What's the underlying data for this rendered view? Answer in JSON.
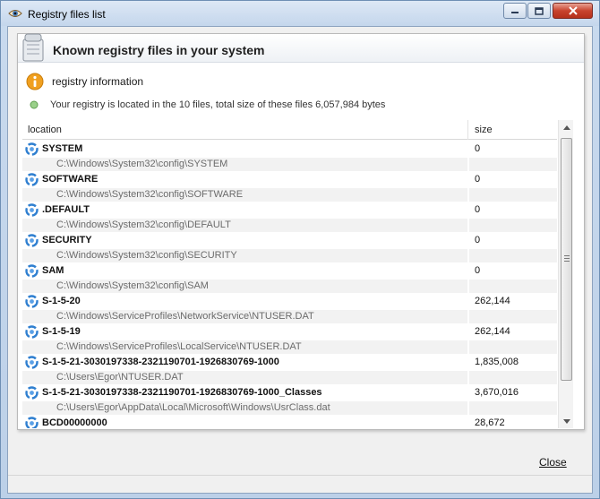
{
  "window": {
    "title": "Registry files list",
    "controls": {
      "minimize": "minimize",
      "maximize": "maximize",
      "close": "close"
    }
  },
  "header": {
    "title": "Known registry files in your system",
    "icon": "registry-hive-icon"
  },
  "info": {
    "label": "registry information",
    "icon": "info-icon",
    "description": "Your registry is located in the 10 files, total size of these files 6,057,984 bytes"
  },
  "table": {
    "columns": [
      "location",
      "size"
    ],
    "entries": [
      {
        "name": "SYSTEM",
        "path": "C:\\Windows\\System32\\config\\SYSTEM",
        "size": "0"
      },
      {
        "name": "SOFTWARE",
        "path": "C:\\Windows\\System32\\config\\SOFTWARE",
        "size": "0"
      },
      {
        "name": ".DEFAULT",
        "path": "C:\\Windows\\System32\\config\\DEFAULT",
        "size": "0"
      },
      {
        "name": "SECURITY",
        "path": "C:\\Windows\\System32\\config\\SECURITY",
        "size": "0"
      },
      {
        "name": "SAM",
        "path": "C:\\Windows\\System32\\config\\SAM",
        "size": "0"
      },
      {
        "name": "S-1-5-20",
        "path": "C:\\Windows\\ServiceProfiles\\NetworkService\\NTUSER.DAT",
        "size": "262,144"
      },
      {
        "name": "S-1-5-19",
        "path": "C:\\Windows\\ServiceProfiles\\LocalService\\NTUSER.DAT",
        "size": "262,144"
      },
      {
        "name": "S-1-5-21-3030197338-2321190701-1926830769-1000",
        "path": "C:\\Users\\Egor\\NTUSER.DAT",
        "size": "1,835,008"
      },
      {
        "name": "S-1-5-21-3030197338-2321190701-1926830769-1000_Classes",
        "path": "C:\\Users\\Egor\\AppData\\Local\\Microsoft\\Windows\\UsrClass.dat",
        "size": "3,670,016"
      },
      {
        "name": "BCD00000000",
        "path": "",
        "size": "28,672"
      }
    ]
  },
  "footer": {
    "close_label": "Close"
  },
  "colors": {
    "frame": "#c5d6ea",
    "close_button": "#c8432e",
    "info_icon": "#f0a020",
    "entry_icon": "#2f7fd0"
  }
}
